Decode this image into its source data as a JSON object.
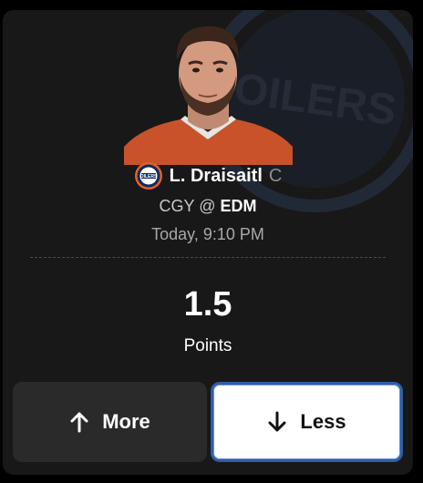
{
  "player": {
    "name": "L. Draisaitl",
    "position": "C"
  },
  "matchup": {
    "away": "CGY",
    "separator": "@",
    "home": "EDM"
  },
  "game_time": "Today, 9:10 PM",
  "projection": {
    "line": "1.5",
    "stat": "Points"
  },
  "buttons": {
    "more_label": "More",
    "less_label": "Less"
  },
  "background_watermark": "OILERS",
  "colors": {
    "card_bg": "#181818",
    "more_bg": "#2a2a2a",
    "less_bg": "#ffffff",
    "less_border": "#2e5fa8",
    "team_primary": "#0f2a5c",
    "team_accent": "#e2602a"
  },
  "icons": {
    "team_logo": "oilers-logo-icon",
    "more_arrow": "arrow-up-icon",
    "less_arrow": "arrow-down-icon"
  }
}
